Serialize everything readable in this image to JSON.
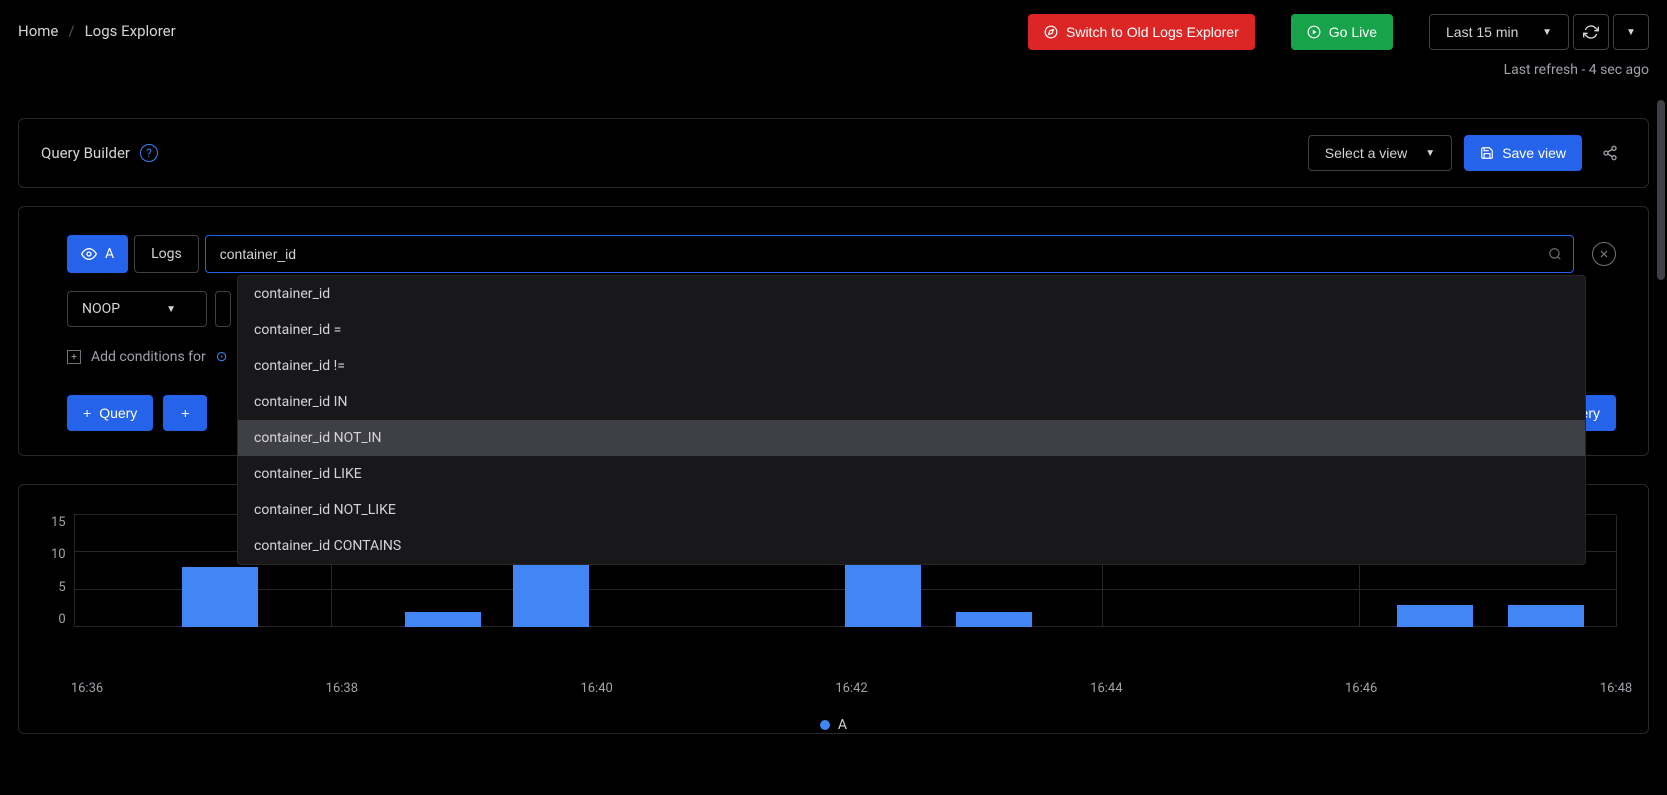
{
  "breadcrumbs": {
    "home": "Home",
    "current": "Logs Explorer"
  },
  "header": {
    "switch_old": "Switch to Old Logs Explorer",
    "go_live": "Go Live",
    "time_range": "Last 15 min",
    "last_refresh": "Last refresh - 4 sec ago"
  },
  "query_builder": {
    "title": "Query Builder",
    "select_view": "Select a view",
    "save_view": "Save view",
    "query_letter": "A",
    "logs_label": "Logs",
    "search_value": "container_id",
    "noop_label": "NOOP",
    "add_conditions_prefix": "Add conditions for",
    "add_query_label": "Query",
    "run_query_label": "Query"
  },
  "autocomplete": {
    "items": [
      "container_id",
      "container_id =",
      "container_id !=",
      "container_id IN",
      "container_id NOT_IN",
      "container_id LIKE",
      "container_id NOT_LIKE",
      "container_id CONTAINS"
    ],
    "highlighted_index": 4
  },
  "chart_data": {
    "type": "bar",
    "categories": [
      "16:36",
      "16:38",
      "16:40",
      "16:42",
      "16:44",
      "16:46",
      "16:48"
    ],
    "bars": [
      {
        "x": 0.07,
        "value": 8
      },
      {
        "x": 0.215,
        "value": 2
      },
      {
        "x": 0.285,
        "value": 11
      },
      {
        "x": 0.5,
        "value": 15
      },
      {
        "x": 0.572,
        "value": 2
      },
      {
        "x": 0.858,
        "value": 3
      },
      {
        "x": 0.93,
        "value": 3
      }
    ],
    "ylim": [
      0,
      15
    ],
    "yticks": [
      0,
      5,
      10,
      15
    ],
    "legend": "A"
  }
}
